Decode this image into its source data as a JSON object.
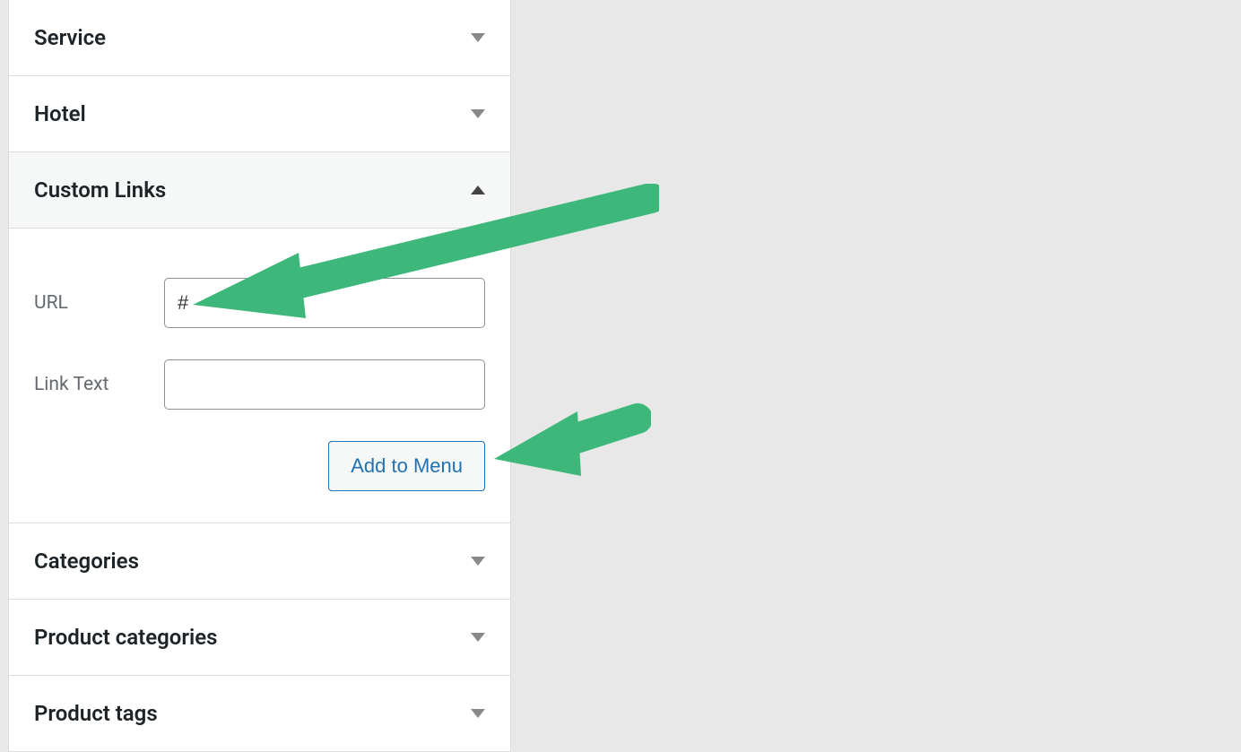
{
  "panels": {
    "service": {
      "title": "Service"
    },
    "hotel": {
      "title": "Hotel"
    },
    "customLinks": {
      "title": "Custom Links",
      "urlLabel": "URL",
      "urlValue": "#",
      "linkTextLabel": "Link Text",
      "linkTextValue": "",
      "addButtonLabel": "Add to Menu"
    },
    "categories": {
      "title": "Categories"
    },
    "productCategories": {
      "title": "Product categories"
    },
    "productTags": {
      "title": "Product tags"
    }
  }
}
